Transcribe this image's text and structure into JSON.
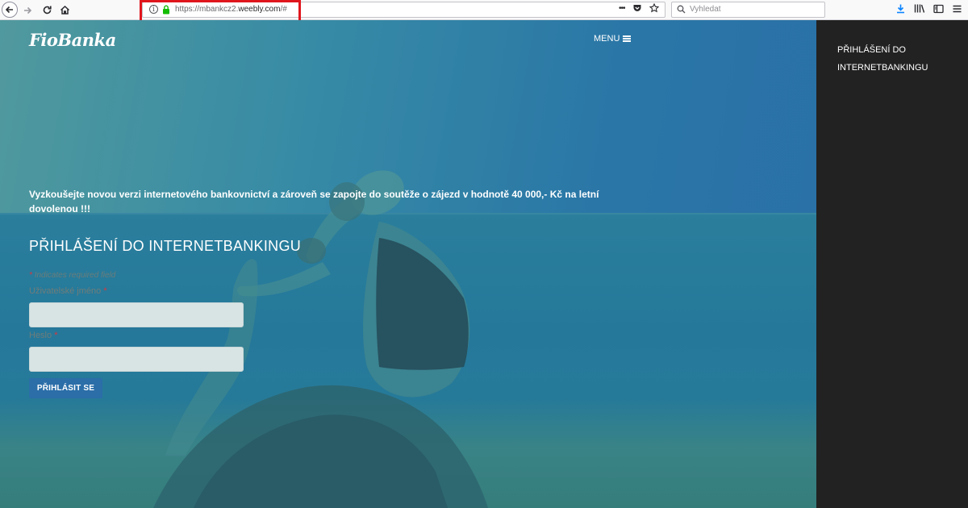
{
  "browser": {
    "url_prefix": "https://mbankcz2.",
    "url_domain": "weebly.com",
    "url_suffix": "/#",
    "search_placeholder": "Vyhledat",
    "page_actions_more": "•••",
    "info_icon_glyph": "i",
    "icons": [
      "back-icon",
      "forward-icon",
      "reload-icon",
      "home-icon",
      "info-icon",
      "lock-icon",
      "more-icon",
      "pocket-icon",
      "bookmark-star-icon",
      "search-icon",
      "download-icon",
      "library-icon",
      "sidebar-icon",
      "hamburger-menu-icon"
    ],
    "highlight_color": "#e0161d"
  },
  "site": {
    "logo": "FioBanka",
    "menu_label": "MENU",
    "promo_text": "Vyzkoušejte novou verzi internetového bankovnictví a zároveň se zapojte do soutěže o zájezd v hodnotě 40 000,- Kč na letní dovolenou !!!",
    "login_title": "PŘIHLÁŠENÍ DO INTERNETBANKINGU",
    "required_note": "Indicates required field",
    "required_marker": "*",
    "username_label": "Uživatelské jméno",
    "password_label": "Heslo",
    "username_value": "",
    "password_value": "",
    "submit_label": "PŘIHLÁSIT SE",
    "button_color": "#2b6ea8"
  },
  "side_menu": {
    "items": [
      {
        "label": "PŘIHLÁŠENÍ DO INTERNETBANKINGU"
      }
    ],
    "background": "#222222"
  }
}
